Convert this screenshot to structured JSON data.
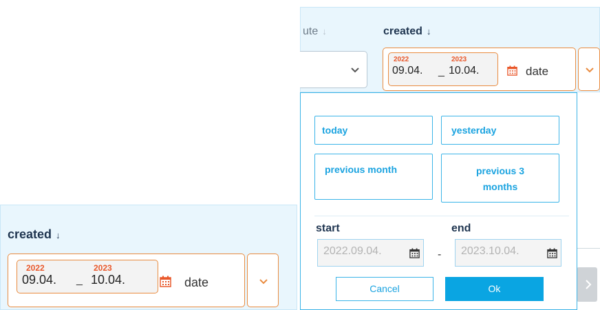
{
  "bottom_filter": {
    "header_label": "created",
    "sort_arrow": "↓",
    "from_year": "2022",
    "from_date": "09.04.",
    "range_sep": "_",
    "to_year": "2023",
    "to_date": "10.04.",
    "mode_label": "date",
    "calendar_icon": "calendar-icon",
    "toggle_icon": "chevron-down-icon"
  },
  "top_filter": {
    "prev_header": "ute",
    "prev_arrow": "↓",
    "header_label": "created",
    "sort_arrow": "↓",
    "from_year": "2022",
    "from_date": "09.04.",
    "range_sep": "_",
    "to_year": "2023",
    "to_date": "10.04.",
    "mode_label": "date"
  },
  "dropdown": {
    "presets": {
      "today": "today",
      "yesterday": "yesterday",
      "previous_month": "previous month",
      "previous_3_months": "previous 3 months"
    },
    "start_label": "start",
    "end_label": "end",
    "start_value": "2022.09.04.",
    "end_value": "2023.10.04.",
    "range_dash": "-",
    "cancel_label": "Cancel",
    "ok_label": "Ok"
  },
  "colors": {
    "accent_blue": "#0aa5e2",
    "accent_orange": "#e98b3f",
    "year_red": "#e9582b",
    "panel_bg": "#e9f6fd"
  }
}
